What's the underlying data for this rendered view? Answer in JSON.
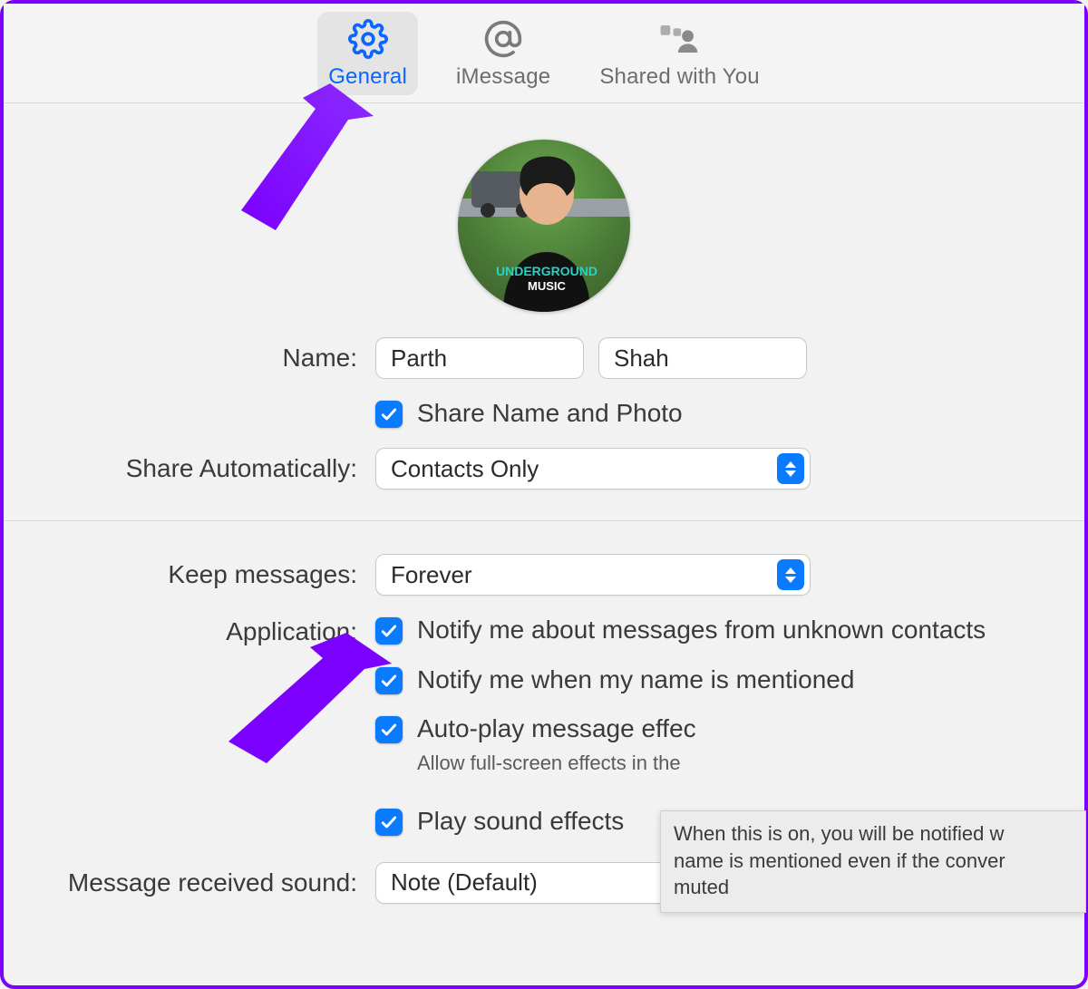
{
  "colors": {
    "accent": "#0a7aff",
    "annotation": "#7b00ff"
  },
  "tabs": {
    "general": "General",
    "imessage": "iMessage",
    "shared": "Shared with You",
    "active": "general"
  },
  "name": {
    "label": "Name:",
    "first": "Parth",
    "last": "Shah"
  },
  "share_name_photo": {
    "checked": true,
    "label": "Share Name and Photo"
  },
  "share_automatically": {
    "label": "Share Automatically:",
    "value": "Contacts Only"
  },
  "keep_messages": {
    "label": "Keep messages:",
    "value": "Forever"
  },
  "application": {
    "label": "Application:",
    "options": [
      {
        "checked": true,
        "label": "Notify me about messages from unknown contacts"
      },
      {
        "checked": true,
        "label": "Notify me when my name is mentioned"
      },
      {
        "checked": true,
        "label": "Auto-play message effec",
        "help": "Allow full-screen effects in the"
      },
      {
        "checked": true,
        "label": "Play sound effects"
      }
    ]
  },
  "message_received_sound": {
    "label": "Message received sound:",
    "value": "Note (Default)"
  },
  "tooltip": {
    "line1": "When this is on, you will be notified w",
    "line2": "name is mentioned even if the conver",
    "line3": "muted"
  }
}
